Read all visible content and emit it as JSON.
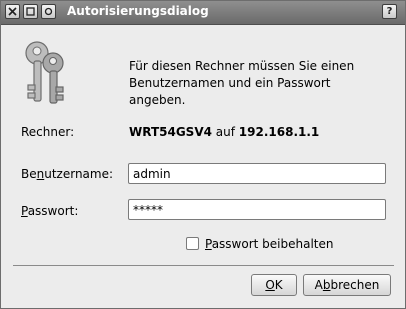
{
  "window": {
    "title": "Autorisierungsdialog",
    "help": "?"
  },
  "message": "Für diesen Rechner müssen Sie einen Benutzernamen und ein Passwort angeben.",
  "computer": {
    "label": "Rechner:",
    "host": "WRT54GSV4",
    "connector": "auf",
    "address": "192.168.1.1"
  },
  "username": {
    "label_pre": "Be",
    "label_key": "n",
    "label_post": "utzername:",
    "value": "admin"
  },
  "password": {
    "label_pre": "",
    "label_key": "P",
    "label_post": "asswort:",
    "value": "*****"
  },
  "keep_password": {
    "label_pre": "",
    "label_key": "P",
    "label_post": "asswort beibehalten",
    "checked": false
  },
  "buttons": {
    "ok": {
      "pre": "",
      "key": "O",
      "post": "K"
    },
    "cancel": {
      "pre": "A",
      "key": "b",
      "post": "brechen"
    }
  }
}
